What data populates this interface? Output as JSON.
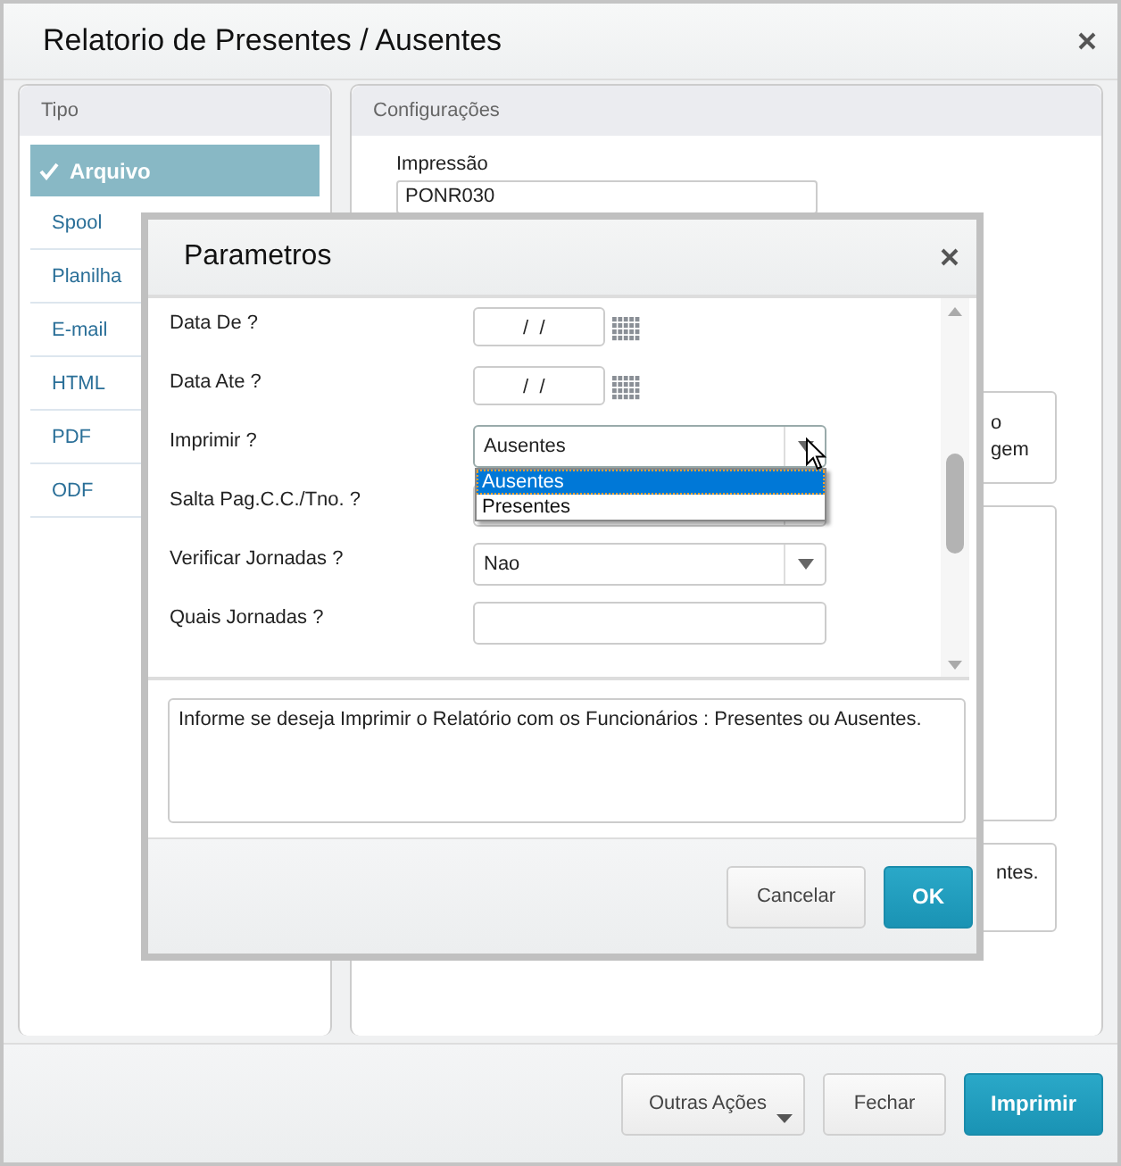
{
  "window": {
    "title": "Relatorio de Presentes / Ausentes"
  },
  "tipo": {
    "title": "Tipo",
    "items": [
      {
        "label": "Arquivo",
        "selected": true
      },
      {
        "label": "Spool",
        "selected": false
      },
      {
        "label": "Planilha",
        "selected": false
      },
      {
        "label": "E-mail",
        "selected": false
      },
      {
        "label": "HTML",
        "selected": false
      },
      {
        "label": "PDF",
        "selected": false
      },
      {
        "label": "ODF",
        "selected": false
      }
    ]
  },
  "configuracoes": {
    "title": "Configurações",
    "impressao_label": "Impressão",
    "impressao_value": "PONR030",
    "box_1_lines": [
      "o",
      "gem"
    ],
    "box_3_text": "ntes."
  },
  "dialog": {
    "title": "Parametros",
    "params": [
      {
        "kind": "date",
        "label": "Data De ?",
        "value": " /  /"
      },
      {
        "kind": "date",
        "label": "Data Ate ?",
        "value": " /  /"
      },
      {
        "kind": "select",
        "label": "Imprimir ?",
        "value": "Ausentes",
        "open": true,
        "options": [
          {
            "label": "Ausentes",
            "selected": true
          },
          {
            "label": "Presentes",
            "selected": false
          }
        ]
      },
      {
        "kind": "select",
        "label": "Salta Pag.C.C./Tno. ?"
      },
      {
        "kind": "select",
        "label": "Verificar Jornadas ?",
        "value": "Nao"
      },
      {
        "kind": "text",
        "label": "Quais Jornadas ?"
      }
    ],
    "help": "Informe se deseja Imprimir o Relatório com os Funcionários : Presentes ou Ausentes.",
    "buttons": [
      {
        "label": "Cancelar",
        "primary": false
      },
      {
        "label": "OK",
        "primary": true
      }
    ]
  },
  "footer": {
    "buttons": [
      {
        "label": "Outras Ações",
        "primary": false,
        "menu": true
      },
      {
        "label": "Fechar",
        "primary": false,
        "menu": false
      },
      {
        "label": "Imprimir",
        "primary": true,
        "menu": false
      }
    ]
  }
}
